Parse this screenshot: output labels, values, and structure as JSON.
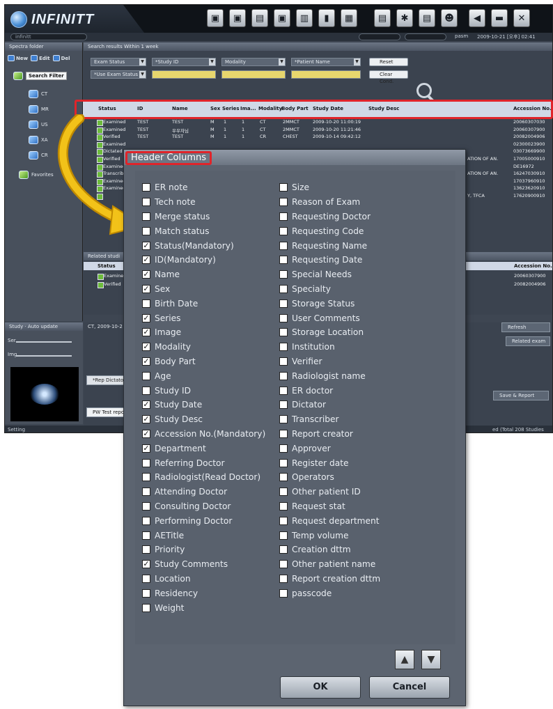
{
  "app": {
    "logo": "INFINITT",
    "user_field": "infinitt",
    "user": "pasm",
    "datetime": "2009-10-21 [오후] 02:41",
    "topbar_icons": [
      "worklist-icon",
      "viewer-icon",
      "report-icon",
      "print-icon",
      "export-icon",
      "storage-icon",
      "network-icon",
      "folder-icon",
      "settings-icon",
      "list-icon",
      "user-icon",
      "logout-icon",
      "minimize-icon",
      "close-icon"
    ]
  },
  "left_panel": {
    "title": "Spectra folder",
    "tools": [
      "New",
      "Edit",
      "Del"
    ],
    "tree": [
      {
        "label": "Search Filter"
      },
      {
        "label": "CT"
      },
      {
        "label": "MR"
      },
      {
        "label": "US"
      },
      {
        "label": "XA"
      },
      {
        "label": "CR"
      },
      {
        "label": "Favorites"
      }
    ]
  },
  "search": {
    "title": "Search results  Within 1 week",
    "filters_row1": [
      "Exam Status",
      "*Study ID",
      "Modality",
      "*Patient Name"
    ],
    "filters_row2": [
      "*Use Exam Status",
      "",
      "",
      ""
    ],
    "reset": "Reset",
    "clear": "Clear Cond."
  },
  "table": {
    "columns": [
      "Status",
      "ID",
      "Name",
      "Sex",
      "Series",
      "Ima...",
      "Modality",
      "Body Part",
      "Study Date",
      "Study Desc",
      "Accession No."
    ],
    "rows": [
      {
        "status": "Examined",
        "id": "TEST",
        "name": "TEST",
        "sex": "M",
        "series": "1",
        "ima": "1",
        "modality": "CT",
        "body": "2MMCT",
        "date": "2009-10-20 11:00:19",
        "acc": "20060307030"
      },
      {
        "status": "Examined",
        "id": "TEST",
        "name": "우우자님",
        "sex": "M",
        "series": "1",
        "ima": "1",
        "modality": "CT",
        "body": "2MMCT",
        "date": "2009-10-20 11:21:46",
        "acc": "20060307900"
      },
      {
        "status": "Verified",
        "id": "TEST",
        "name": "TEST",
        "sex": "M",
        "series": "1",
        "ima": "1",
        "modality": "CR",
        "body": "CHEST",
        "date": "2009-10-14 09:42:12",
        "acc": "20082004906"
      },
      {
        "status": "Examined",
        "id": "",
        "name": "",
        "sex": "",
        "series": "",
        "ima": "",
        "modality": "",
        "body": "",
        "date": "",
        "acc": "02300023900"
      },
      {
        "status": "Dictated",
        "id": "",
        "name": "",
        "sex": "",
        "series": "",
        "ima": "",
        "modality": "",
        "body": "",
        "date": "",
        "acc": "03073669900"
      },
      {
        "status": "Verified",
        "id": "",
        "name": "",
        "sex": "",
        "series": "",
        "ima": "",
        "modality": "",
        "body": "",
        "date": "",
        "acc": "17005000910"
      },
      {
        "status": "Examined",
        "id": "",
        "name": "",
        "sex": "",
        "series": "",
        "ima": "",
        "modality": "",
        "body": "",
        "date": "",
        "acc": "DE16972"
      },
      {
        "status": "Transcribed",
        "id": "",
        "name": "",
        "sex": "",
        "series": "",
        "ima": "",
        "modality": "",
        "body": "",
        "date": "",
        "acc": "16247030910"
      },
      {
        "status": "Examined",
        "id": "",
        "name": "",
        "sex": "",
        "series": "",
        "ima": "",
        "modality": "",
        "body": "",
        "date": "",
        "acc": "17037960910"
      },
      {
        "status": "Examined",
        "id": "",
        "name": "",
        "sex": "",
        "series": "",
        "ima": "",
        "modality": "",
        "body": "",
        "date": "",
        "acc": "13623620910"
      },
      {
        "status": "",
        "id": "",
        "name": "",
        "sex": "",
        "series": "",
        "ima": "",
        "modality": "",
        "body": "",
        "date": "",
        "acc": "17620900910"
      }
    ],
    "desc_fragments": [
      "ATION OF AN.",
      "ATION OF AN.",
      "Y, TFCA"
    ]
  },
  "related": {
    "title": "Related studi",
    "columns": [
      "Status",
      "Accession No."
    ],
    "rows": [
      {
        "status": "Examined",
        "acc": "20060307900"
      },
      {
        "status": "Verified",
        "acc": "20082004906"
      }
    ]
  },
  "lower": {
    "study_label": "Study",
    "auto_label": "Auto update",
    "sliders": [
      "Ser.",
      "Img."
    ],
    "date_fragment": "CT, 2009-10-2",
    "refresh": "Refresh",
    "related_exam": "Related exam",
    "dictator_placeholder": "*Rep Dictator",
    "save_report": "Save & Report",
    "test_report": "PW Test report",
    "status_left": "Setting",
    "status_right": "ed (Total 208 Studies"
  },
  "dialog": {
    "title": "Header Columns",
    "left_column": [
      {
        "label": "ER note",
        "checked": false
      },
      {
        "label": "Tech note",
        "checked": false
      },
      {
        "label": "Merge status",
        "checked": false
      },
      {
        "label": "Match status",
        "checked": false
      },
      {
        "label": "Status(Mandatory)",
        "checked": true
      },
      {
        "label": "ID(Mandatory)",
        "checked": true
      },
      {
        "label": "Name",
        "checked": true
      },
      {
        "label": "Sex",
        "checked": true
      },
      {
        "label": "Birth Date",
        "checked": false
      },
      {
        "label": "Series",
        "checked": true
      },
      {
        "label": "Image",
        "checked": true
      },
      {
        "label": "Modality",
        "checked": true
      },
      {
        "label": "Body Part",
        "checked": true
      },
      {
        "label": "Age",
        "checked": false
      },
      {
        "label": "Study ID",
        "checked": false
      },
      {
        "label": "Study Date",
        "checked": true
      },
      {
        "label": "Study Desc",
        "checked": true
      },
      {
        "label": "Accession No.(Mandatory)",
        "checked": true
      },
      {
        "label": "Department",
        "checked": true
      },
      {
        "label": "Referring Doctor",
        "checked": false
      },
      {
        "label": "Radiologist(Read Doctor)",
        "checked": false
      },
      {
        "label": "Attending Doctor",
        "checked": false
      },
      {
        "label": "Consulting Doctor",
        "checked": false
      },
      {
        "label": "Performing Doctor",
        "checked": false
      },
      {
        "label": "AETitle",
        "checked": false
      },
      {
        "label": "Priority",
        "checked": false
      },
      {
        "label": "Study Comments",
        "checked": true
      },
      {
        "label": "Location",
        "checked": false
      },
      {
        "label": "Residency",
        "checked": false
      },
      {
        "label": "Weight",
        "checked": false
      }
    ],
    "right_column": [
      {
        "label": "Size",
        "checked": false
      },
      {
        "label": "Reason of Exam",
        "checked": false
      },
      {
        "label": "Requesting Doctor",
        "checked": false
      },
      {
        "label": "Requesting Code",
        "checked": false
      },
      {
        "label": "Requesting Name",
        "checked": false
      },
      {
        "label": "Requesting Date",
        "checked": false
      },
      {
        "label": "Special Needs",
        "checked": false
      },
      {
        "label": "Specialty",
        "checked": false
      },
      {
        "label": "Storage Status",
        "checked": false
      },
      {
        "label": "User Comments",
        "checked": false
      },
      {
        "label": "Storage Location",
        "checked": false
      },
      {
        "label": "Institution",
        "checked": false
      },
      {
        "label": "Verifier",
        "checked": false
      },
      {
        "label": "Radiologist name",
        "checked": false
      },
      {
        "label": "ER doctor",
        "checked": false
      },
      {
        "label": "Dictator",
        "checked": false
      },
      {
        "label": "Transcriber",
        "checked": false
      },
      {
        "label": "Report creator",
        "checked": false
      },
      {
        "label": "Approver",
        "checked": false
      },
      {
        "label": "Register date",
        "checked": false
      },
      {
        "label": "Operators",
        "checked": false
      },
      {
        "label": "Other patient ID",
        "checked": false
      },
      {
        "label": "Request stat",
        "checked": false
      },
      {
        "label": "Request department",
        "checked": false
      },
      {
        "label": "Temp volume",
        "checked": false
      },
      {
        "label": "Creation dttm",
        "checked": false
      },
      {
        "label": "Other patient name",
        "checked": false
      },
      {
        "label": "Report creation dttm",
        "checked": false
      },
      {
        "label": "passcode",
        "checked": false
      }
    ],
    "ok": "OK",
    "cancel": "Cancel",
    "move_up_icon": "triangle-up-icon",
    "move_down_icon": "triangle-down-icon"
  },
  "colors": {
    "highlight_red": "#e0242a",
    "arrow_yellow": "#f2c219",
    "dialog_bg": "#5c6470",
    "header_row": "#d0d8e6"
  }
}
